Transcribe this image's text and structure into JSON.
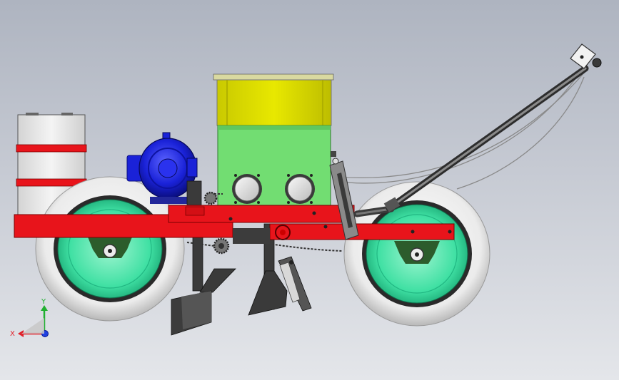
{
  "triad": {
    "x_label": "X",
    "y_label": "Y",
    "x_color": "#e0202a",
    "y_color": "#20b030",
    "z_color": "#2040e0"
  },
  "colors": {
    "frame_red": "#e8141b",
    "hopper_yellow": "#dede00",
    "box_green": "#72dd72",
    "wheel_hub": "#40e0a0",
    "wheel_tire": "#f2f2f2",
    "motor_blue": "#1a22d8",
    "tank": "#e9e9e9",
    "steel": "#444444"
  }
}
